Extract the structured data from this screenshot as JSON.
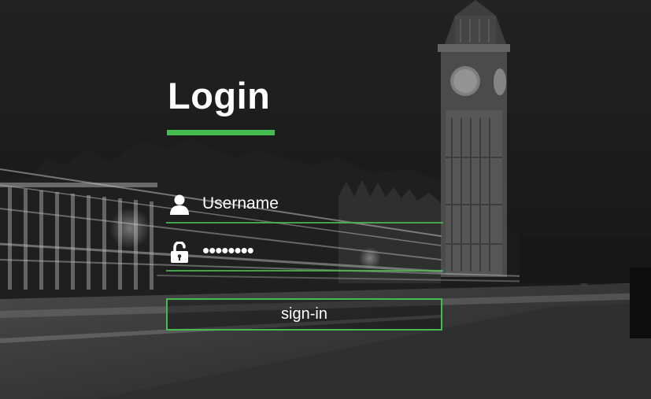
{
  "login": {
    "title": "Login",
    "username": {
      "placeholder": "Username",
      "icon": "user-icon"
    },
    "password": {
      "placeholder": "••••••••",
      "icon": "unlock-icon"
    },
    "signin_label": "sign-in"
  },
  "colors": {
    "accent": "#46bb4f",
    "text": "#ffffff",
    "background": "#1c1c1c"
  },
  "background": {
    "scene": "night-city-big-ben-monochrome"
  }
}
